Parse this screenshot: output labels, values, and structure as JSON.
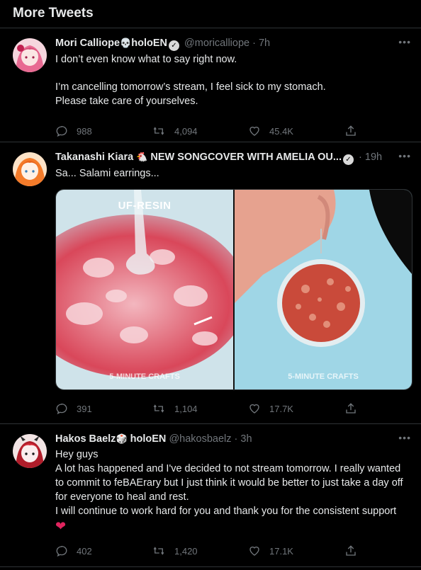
{
  "header": {
    "title": "More Tweets"
  },
  "icons": {
    "reply": "reply-icon",
    "retweet": "retweet-icon",
    "like": "heart-icon",
    "share": "share-icon",
    "more": "more-icon",
    "verified": "verified-badge-icon"
  },
  "colors": {
    "background": "#000000",
    "text": "#e7e9ea",
    "muted": "#71767b",
    "divider": "#2f3336",
    "heart": "#e0245e"
  },
  "tweets": [
    {
      "name": "Mori Calliope",
      "name_emoji": "💀",
      "name_suffix": "holoEN",
      "handle": "@moricalliope",
      "time": "· 7h",
      "lines": [
        "I don’t even know what to say right now.",
        "",
        "I’m cancelling tomorrow’s stream, I feel sick to my stomach.",
        "Please take care of yourselves."
      ],
      "replies": "988",
      "retweets": "4,094",
      "likes": "45.4K"
    },
    {
      "name": "Takanashi Kiara",
      "name_emoji": "🐔",
      "name_suffix": "NEW SONGCOVER WITH AMELIA OU...",
      "handle": "",
      "time": "· 19h",
      "lines": [
        "Sa... Salami earrings..."
      ],
      "media": {
        "left_caption": "UF-RESIN",
        "left_watermark": "5-MINUTE CRAFTS",
        "right_watermark": "5-MINUTE CRAFTS"
      },
      "replies": "391",
      "retweets": "1,104",
      "likes": "17.7K"
    },
    {
      "name": "Hakos Baelz",
      "name_emoji": "🎲",
      "name_suffix": "holoEN",
      "handle": "@hakosbaelz",
      "time": "· 3h",
      "lines": [
        "Hey guys",
        "A lot has happened and I've decided to not stream tomorrow. I really wanted to commit to feBAErary but I just think it would be better to just take a day off for everyone to heal and rest.",
        "I will continue to work hard for you and thank you for the consistent support"
      ],
      "trailing_emoji": "❤",
      "replies": "402",
      "retweets": "1,420",
      "likes": "17.1K"
    }
  ]
}
